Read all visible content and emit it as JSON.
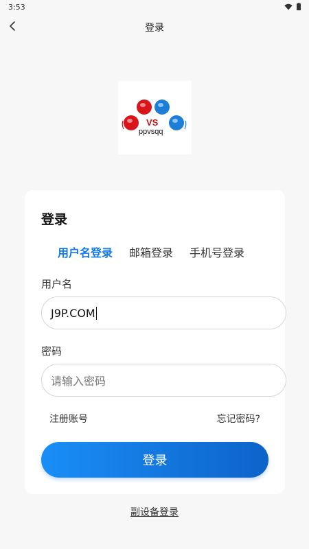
{
  "status_bar": {
    "time": "3:53"
  },
  "nav": {
    "title": "登录"
  },
  "logo": {
    "vs": "VS",
    "name": "ppvsqq"
  },
  "card": {
    "title": "登录",
    "tabs": [
      {
        "label": "用户名登录",
        "active": true
      },
      {
        "label": "邮箱登录",
        "active": false
      },
      {
        "label": "手机号登录",
        "active": false
      }
    ],
    "username": {
      "label": "用户名",
      "value": "J9P.COM"
    },
    "password": {
      "label": "密码",
      "placeholder": "请输入密码"
    },
    "register_link": "注册账号",
    "forgot_link": "忘记密码?",
    "login_button": "登录"
  },
  "secondary_login": "副设备登录",
  "colors": {
    "accent": "#1479ea",
    "button_start": "#1a8ef7",
    "button_end": "#0d63c9"
  }
}
